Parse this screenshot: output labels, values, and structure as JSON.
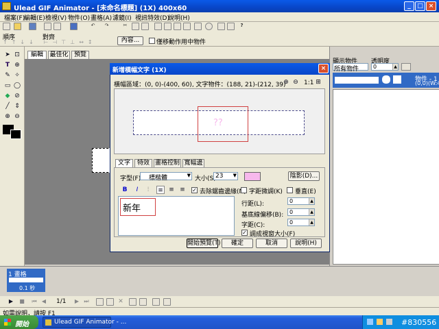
{
  "window": {
    "title": "Ulead GIF Animator - [未命名標題] (1X) 400x60"
  },
  "menu": [
    "檔案(F)",
    "編輯(E)",
    "檢視(V)",
    "物件(O)",
    "畫格(A)",
    "濾鏡(I)",
    "視訊特效(D)",
    "說明(H)"
  ],
  "toolbar3": {
    "order_label": "順序",
    "align_label": "對齊",
    "content_button": "內容...",
    "move_checkbox": "僅移動作用中物件"
  },
  "tabs": [
    "編輯",
    "最佳化",
    "預覽"
  ],
  "right_panel": {
    "show_label": "顯示物件",
    "opacity_label": "透明度",
    "show_value": "所有物件",
    "opacity_value": "0",
    "object_name": "物件 - 1",
    "object_info": "(0,0)(W:40"
  },
  "timeline": {
    "frame_label": "1 畫格",
    "frame_time": "0.1 秒",
    "counter": "1/1"
  },
  "status": {
    "text": "如需說明，請按 F1"
  },
  "taskbar": {
    "start": "開始",
    "item": "Ulead GIF Animator - ...",
    "clock": "#830556"
  },
  "dialog": {
    "title": "新增橫幅文字 (1X)",
    "info": "橫幅區域：(0, 0)-(400, 60), 文字物件：(188, 21)-(212, 39)",
    "zoom_ratio": "1:1",
    "preview_text": "??",
    "tabs": [
      "文字",
      "特效",
      "畫格控制",
      "寬幅邊"
    ],
    "font_label": "字型(F)",
    "font_value": "標楷體",
    "size_label": "大小(S)",
    "size_value": "23",
    "shadow_button": "陰影(D)...",
    "bold": "B",
    "italic": "I",
    "smooth_checkbox": "去除鋸齒邊緣(N)",
    "spacing_checkbox": "字距微調(K)",
    "vertical_checkbox": "垂直(E)",
    "text_value": "新年",
    "line_spacing_label": "行距(L):",
    "line_spacing_value": "0",
    "baseline_label": "基底線偏移(B):",
    "baseline_value": "0",
    "char_spacing_label": "字距(C):",
    "char_spacing_value": "0",
    "autofit_checkbox": "調成視窗大小(F)",
    "buttons": {
      "start_preview": "開始預覽(T)",
      "ok": "確定",
      "cancel": "取消",
      "help": "說明(H)"
    },
    "colors": {
      "text_color": "#f7b8ec",
      "highlight": "#d04040"
    }
  }
}
